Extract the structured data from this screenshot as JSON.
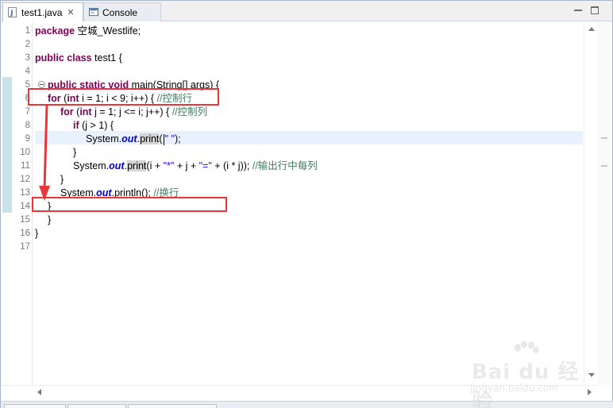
{
  "tabs": [
    {
      "label": "test1.java",
      "icon": "java-file-icon",
      "active": true,
      "closable": true
    },
    {
      "label": "Console",
      "icon": "console-icon",
      "active": false
    }
  ],
  "editor": {
    "line_numbers": [
      "1",
      "2",
      "3",
      "4",
      "5",
      "6",
      "7",
      "8",
      "9",
      "10",
      "11",
      "12",
      "13",
      "14",
      "15",
      "16",
      "17"
    ],
    "current_line": 9,
    "code": {
      "l1_kw": "package",
      "l1_rest": " 空城_Westlife;",
      "l3_kw": "public class",
      "l3_rest": " test1 {",
      "l5_kw": "public static void",
      "l5_rest": " main(String[] args) {",
      "l6_kw1": "for",
      "l6_a": " (",
      "l6_kw2": "int",
      "l6_b": " i = 1; i < 9; i++) { ",
      "l6_cm": "//控制行",
      "l7_kw1": "for",
      "l7_a": " (",
      "l7_kw2": "int",
      "l7_b": " j = 1; j <= i; j++) { ",
      "l7_cm": "//控制列",
      "l8_kw": "if",
      "l8_rest": " (j > 1) {",
      "l9_a": "System.",
      "l9_fld": "out",
      "l9_b": ".",
      "l9_occ": "print",
      "l9_c": "(",
      "l9_str": "\" \"",
      "l9_d": ");",
      "l10": "}",
      "l11_a": "System.",
      "l11_fld": "out",
      "l11_b": ".",
      "l11_occ": "print",
      "l11_c": "(i + ",
      "l11_s1": "\"*\"",
      "l11_d": " + j + ",
      "l11_s2": "\"=\"",
      "l11_e": " + (i * j)); ",
      "l11_cm": "//输出行中每列",
      "l12": "}",
      "l13_a": "System.",
      "l13_fld": "out",
      "l13_b": ".println(); ",
      "l13_cm": "//换行",
      "l14": "}",
      "l15": "}",
      "l16": "}"
    }
  },
  "watermark": {
    "brand": "Bai du 经验",
    "url": "jingyan.baidu.com"
  },
  "colors": {
    "keyword": "#7f0055",
    "comment": "#3f7f5f",
    "string": "#2a00ff",
    "field": "#0000c0",
    "annotation": "#e8363b",
    "current_line": "#e8f2fe"
  }
}
